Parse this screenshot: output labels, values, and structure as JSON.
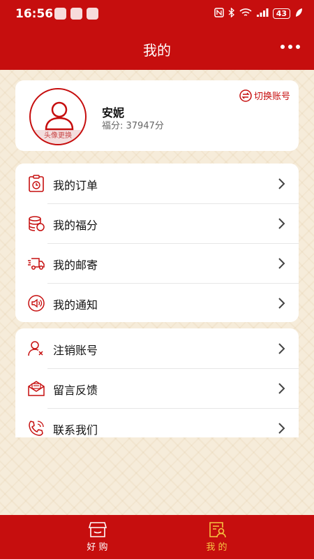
{
  "status_bar": {
    "time": "16:56",
    "battery": "43"
  },
  "header": {
    "title": "我的"
  },
  "profile": {
    "name": "安妮",
    "points_label": "福分: ",
    "points_value": "37947分",
    "avatar_change": "头像更换",
    "switch_account": "切换账号"
  },
  "menu_group_1": [
    {
      "label": "我的订单",
      "icon": "order-clipboard-icon"
    },
    {
      "label": "我的福分",
      "icon": "coins-stack-icon"
    },
    {
      "label": "我的邮寄",
      "icon": "delivery-truck-icon"
    },
    {
      "label": "我的通知",
      "icon": "speaker-icon"
    }
  ],
  "menu_group_2": [
    {
      "label": "注销账号",
      "icon": "user-remove-icon"
    },
    {
      "label": "留言反馈",
      "icon": "mail-feedback-icon"
    },
    {
      "label": "联系我们",
      "icon": "phone-icon"
    }
  ],
  "tabbar": [
    {
      "label": "好 购",
      "icon": "shop-icon",
      "active": false
    },
    {
      "label": "我 的",
      "icon": "profile-doc-icon",
      "active": true
    }
  ],
  "colors": {
    "primary": "#c60e0e",
    "active_tab": "#f6c542",
    "background": "#f6ecda"
  }
}
